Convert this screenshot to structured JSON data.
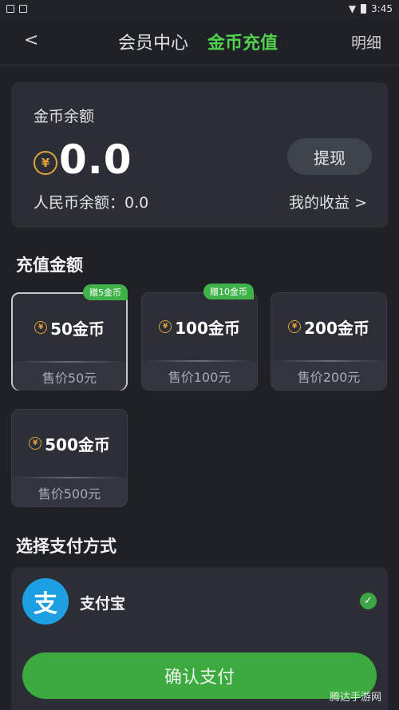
{
  "status_bar": {
    "time": "3:45"
  },
  "nav": {
    "back_glyph": "<",
    "tab_member": "会员中心",
    "tab_recharge": "金币充值",
    "detail_link": "明细"
  },
  "balance": {
    "title": "金币余额",
    "coin_symbol": "¥",
    "amount": "0.0",
    "withdraw_label": "提现",
    "rmb_label": "人民币余额：0.0",
    "earnings_link": "我的收益 >"
  },
  "recharge": {
    "title": "充值金额",
    "packages": [
      {
        "name": "50金币",
        "price": "售价50元",
        "gift": "赠5金币",
        "selected": true
      },
      {
        "name": "100金币",
        "price": "售价100元",
        "gift": "赠10金币",
        "selected": false
      },
      {
        "name": "200金币",
        "price": "售价200元",
        "gift": "",
        "selected": false
      },
      {
        "name": "500金币",
        "price": "售价500元",
        "gift": "",
        "selected": false
      }
    ]
  },
  "payment": {
    "title": "选择支付方式",
    "method_logo_glyph": "支",
    "method_name": "支付宝",
    "check_glyph": "✓",
    "confirm_label": "确认支付"
  },
  "watermark": "腾达手游网",
  "colors": {
    "accent_green": "#4fd14e",
    "button_green": "#3daa3f",
    "coin_gold": "#e0a23a",
    "alipay_blue": "#1ca0e3",
    "background": "#1f2127",
    "card": "#2b2e35"
  }
}
